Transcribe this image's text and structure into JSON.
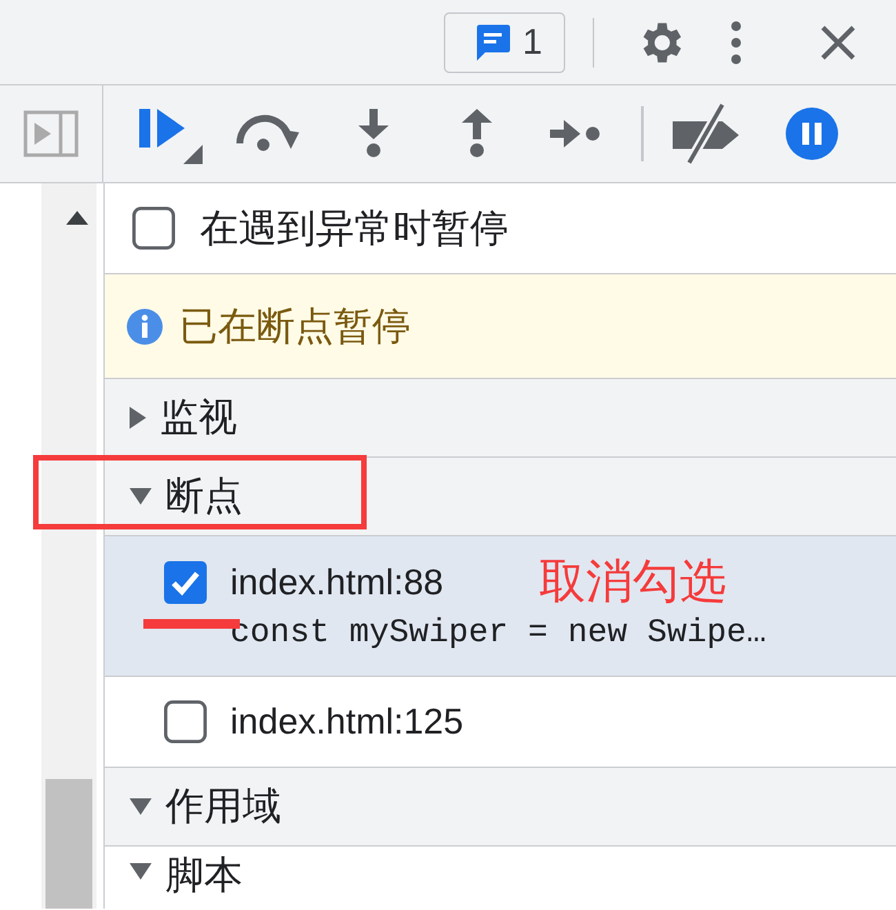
{
  "top_bar": {
    "issues_count": "1"
  },
  "pause_on_exceptions": {
    "label": "在遇到异常时暂停",
    "checked": false
  },
  "status_banner": {
    "text": "已在断点暂停"
  },
  "sections": [
    {
      "title": "监视",
      "expanded": false
    },
    {
      "title": "断点",
      "expanded": true,
      "breakpoints": [
        {
          "location": "index.html:88",
          "code": "const mySwiper = new Swipe…",
          "checked": true,
          "selected": true
        },
        {
          "location": "index.html:125",
          "checked": false,
          "selected": false
        }
      ]
    },
    {
      "title": "作用域",
      "expanded": true
    },
    {
      "title": "脚本",
      "expanded": true
    }
  ],
  "annotations": [
    {
      "kind": "box"
    },
    {
      "kind": "underline"
    },
    {
      "kind": "label",
      "text": "取消勾选"
    }
  ]
}
